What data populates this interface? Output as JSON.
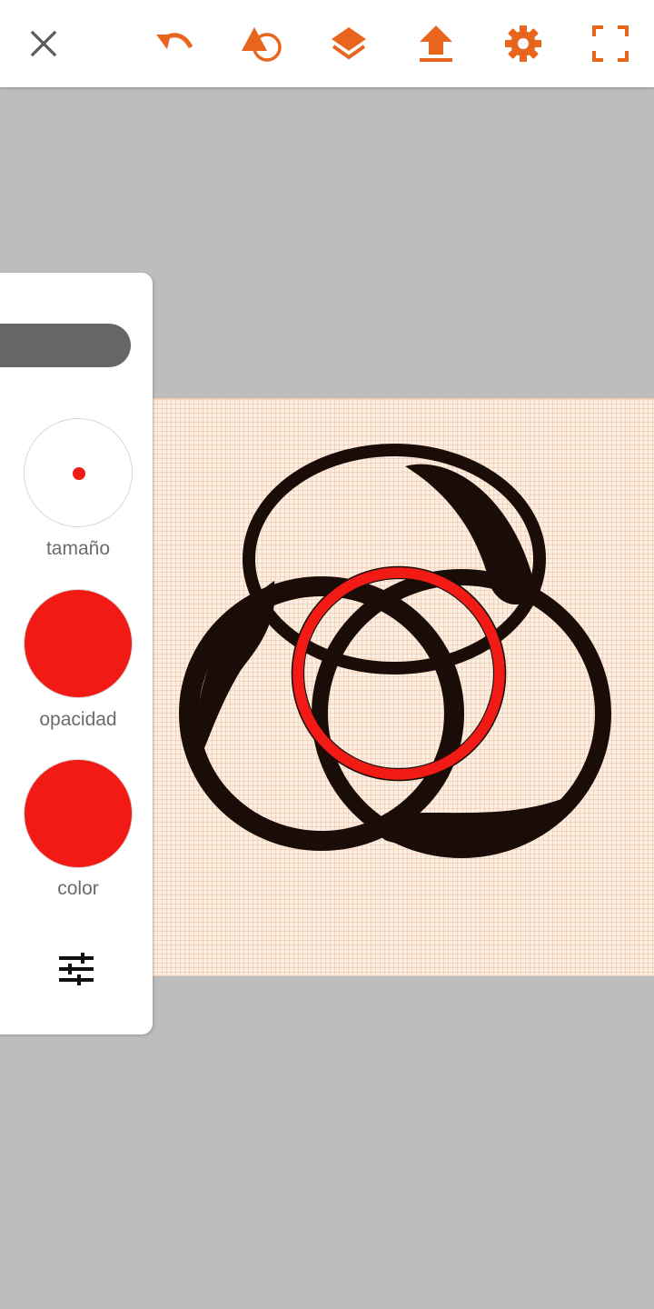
{
  "toolbar": {
    "buttons": [
      {
        "name": "close-button",
        "icon": "close-icon"
      },
      {
        "name": "undo-button",
        "icon": "undo-icon"
      },
      {
        "name": "shapes-button",
        "icon": "shape-triangle-circle-icon"
      },
      {
        "name": "layers-button",
        "icon": "layers-icon"
      },
      {
        "name": "export-button",
        "icon": "upload-icon"
      },
      {
        "name": "settings-button",
        "icon": "gear-icon"
      },
      {
        "name": "fullscreen-button",
        "icon": "fullscreen-icon"
      }
    ]
  },
  "tool_panel": {
    "size_label": "tamaño",
    "opacity_label": "opacidad",
    "color_label": "color",
    "brush_color": "#f21a14"
  },
  "colors": {
    "accent": "#e8651e",
    "toolbar_bg": "#ffffff",
    "workspace_bg": "#bdbdbd",
    "canvas_paper": "#fbeee2",
    "ink": "#1a0d08",
    "brush": "#f21a14"
  }
}
